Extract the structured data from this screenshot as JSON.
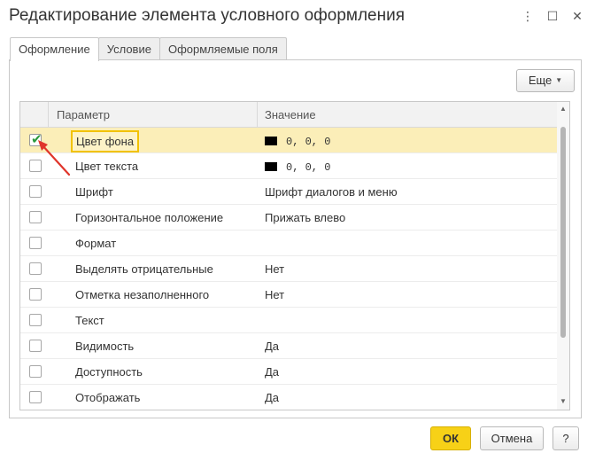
{
  "window": {
    "title": "Редактирование элемента условного оформления",
    "more_icon": "⋮",
    "maximize_icon": "☐",
    "close_icon": "✕"
  },
  "tabs": [
    {
      "label": "Оформление",
      "active": true
    },
    {
      "label": "Условие",
      "active": false
    },
    {
      "label": "Оформляемые поля",
      "active": false
    }
  ],
  "toolbar": {
    "more_label": "Еще",
    "caret_icon": "▼"
  },
  "grid": {
    "columns": {
      "param": "Параметр",
      "value": "Значение"
    },
    "rows": [
      {
        "checked": true,
        "label": "Цвет фона",
        "swatch": "#000000",
        "value": "0, 0, 0"
      },
      {
        "checked": false,
        "label": "Цвет текста",
        "swatch": "#000000",
        "value": "0, 0, 0"
      },
      {
        "checked": false,
        "label": "Шрифт",
        "value": "Шрифт диалогов и меню"
      },
      {
        "checked": false,
        "label": "Горизонтальное положение",
        "value": "Прижать влево"
      },
      {
        "checked": false,
        "label": "Формат",
        "value": ""
      },
      {
        "checked": false,
        "label": "Выделять отрицательные",
        "value": "Нет"
      },
      {
        "checked": false,
        "label": "Отметка незаполненного",
        "value": "Нет"
      },
      {
        "checked": false,
        "label": "Текст",
        "value": ""
      },
      {
        "checked": false,
        "label": "Видимость",
        "value": "Да"
      },
      {
        "checked": false,
        "label": "Доступность",
        "value": "Да"
      },
      {
        "checked": false,
        "label": "Отображать",
        "value": "Да"
      }
    ],
    "scroll_up_icon": "▲",
    "scroll_down_icon": "▼"
  },
  "buttons": {
    "ok": "ОК",
    "cancel": "Отмена",
    "help": "?"
  },
  "colors": {
    "accent": "#f7d117",
    "selected_row": "#fbeeb8",
    "arrow": "#e0352b",
    "check": "#2a9a3c"
  }
}
